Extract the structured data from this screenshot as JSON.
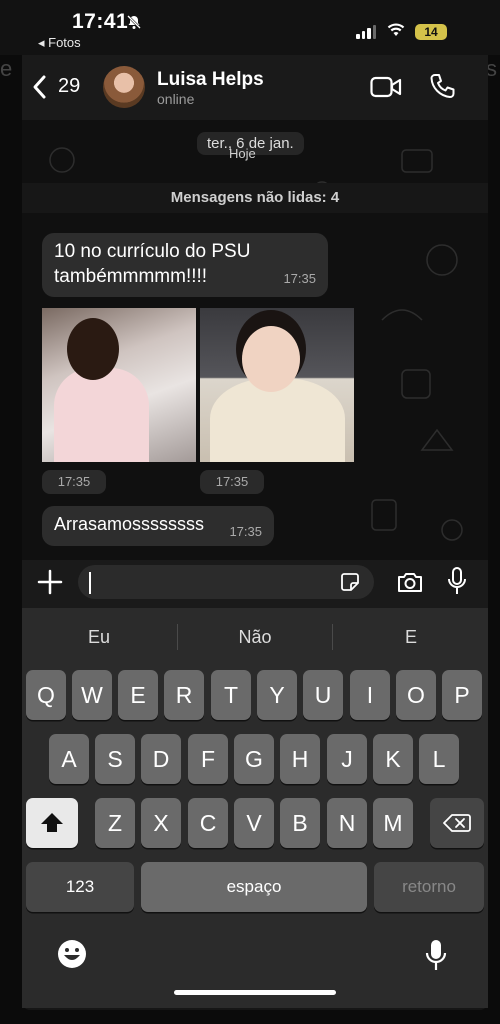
{
  "status": {
    "time": "17:41",
    "back_app": "◂ Fotos",
    "battery": "14"
  },
  "header": {
    "unread_count": "29",
    "contact_name": "Luisa Helps",
    "contact_status": "online"
  },
  "chat": {
    "date_pill": "ter., 6 de jan.",
    "today_pill": "Hoje",
    "unread_banner": "Mensagens não lidas: 4",
    "messages": [
      {
        "text": "10 no currículo do PSU tambémmmmm!!!!",
        "time": "17:35"
      },
      {
        "time": "17:35"
      },
      {
        "time": "17:35"
      },
      {
        "text": "Arrasamossssssss",
        "time": "17:35"
      }
    ]
  },
  "keyboard": {
    "suggestions": [
      "Eu",
      "Não",
      "E"
    ],
    "row1": [
      "Q",
      "W",
      "E",
      "R",
      "T",
      "Y",
      "U",
      "I",
      "O",
      "P"
    ],
    "row2": [
      "A",
      "S",
      "D",
      "F",
      "G",
      "H",
      "J",
      "K",
      "L"
    ],
    "row3": [
      "Z",
      "X",
      "C",
      "V",
      "B",
      "N",
      "M"
    ],
    "numbers": "123",
    "space": "espaço",
    "return": "retorno"
  }
}
